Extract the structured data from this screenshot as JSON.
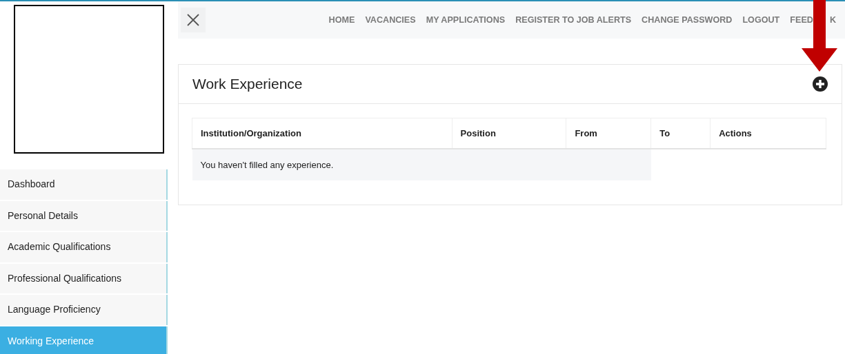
{
  "nav": {
    "items": [
      {
        "label": "HOME"
      },
      {
        "label": "VACANCIES"
      },
      {
        "label": "MY APPLICATIONS"
      },
      {
        "label": "REGISTER TO JOB ALERTS"
      },
      {
        "label": "CHANGE PASSWORD"
      },
      {
        "label": "LOGOUT"
      },
      {
        "label": "FEED",
        "tail": "K"
      }
    ]
  },
  "sidebar": {
    "items": [
      {
        "label": "Dashboard",
        "selected": false
      },
      {
        "label": "Personal Details",
        "selected": false
      },
      {
        "label": "Academic Qualifications",
        "selected": false
      },
      {
        "label": "Professional Qualifications",
        "selected": false
      },
      {
        "label": "Language Proficiency",
        "selected": false
      },
      {
        "label": "Working Experience",
        "selected": true
      }
    ]
  },
  "card": {
    "title": "Work Experience",
    "table": {
      "columns": [
        "Institution/Organization",
        "Position",
        "From",
        "To",
        "Actions"
      ],
      "empty_message": "You haven't filled any experience."
    }
  }
}
